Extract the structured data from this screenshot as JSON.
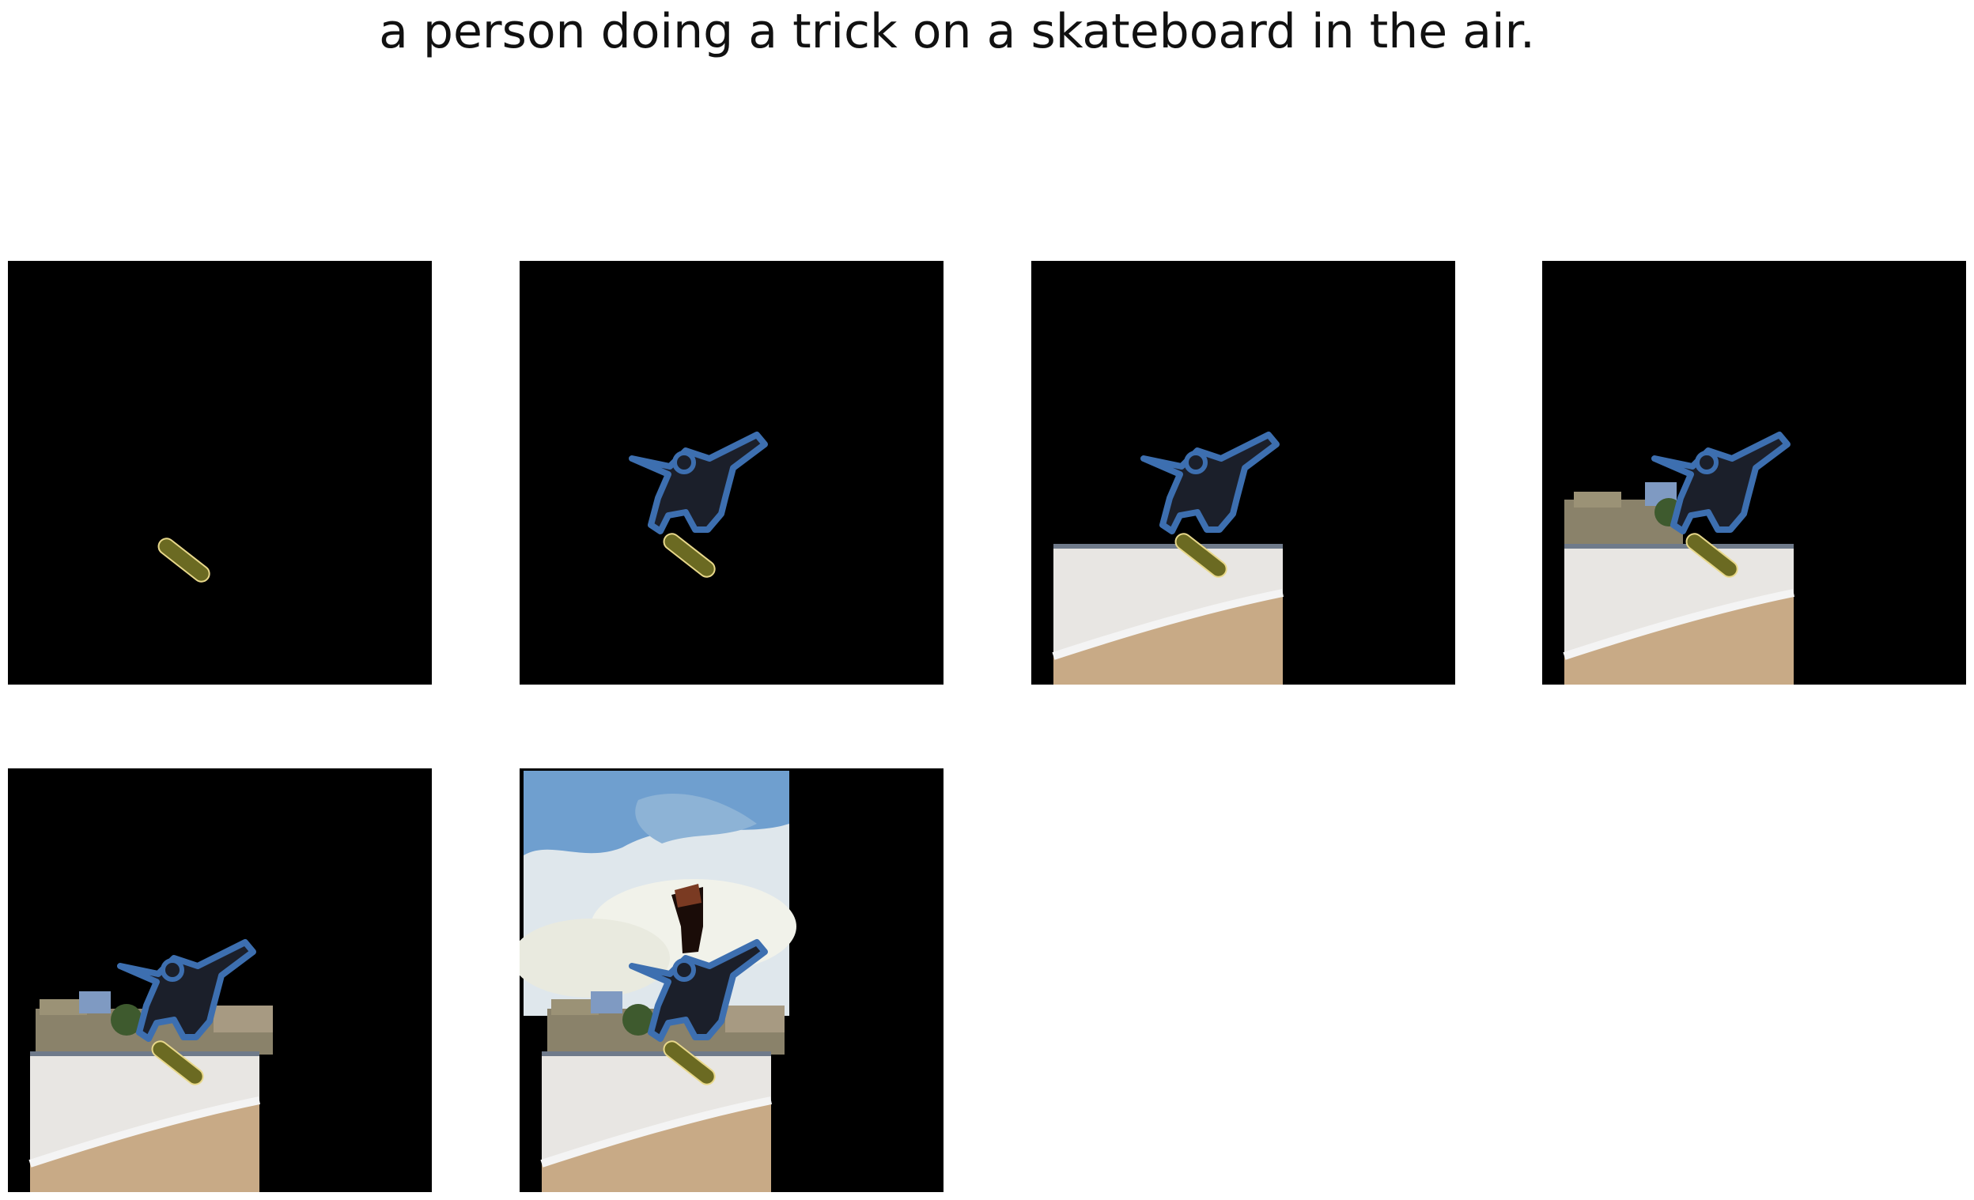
{
  "caption": "a person doing a trick on a skateboard in the air.",
  "colors": {
    "background": "#000000",
    "skateboard": "#6b6a22",
    "outline": "#3d6fb0",
    "skater": "#1b1f2a",
    "ramp": "#d9d6d2",
    "ground": "#c8aa86",
    "trees": "#6f6a55",
    "sky": "#d6e3ee"
  },
  "panels": [
    {
      "name": "panel-1",
      "layers": [
        "skateboard"
      ]
    },
    {
      "name": "panel-2",
      "layers": [
        "skateboard",
        "skater"
      ]
    },
    {
      "name": "panel-3",
      "layers": [
        "ramp",
        "skateboard",
        "skater"
      ]
    },
    {
      "name": "panel-4",
      "layers": [
        "ramp",
        "trees",
        "skateboard",
        "skater"
      ]
    },
    {
      "name": "panel-5",
      "layers": [
        "ramp",
        "trees-wide",
        "skateboard",
        "skater"
      ]
    },
    {
      "name": "panel-6",
      "layers": [
        "sky",
        "ramp",
        "trees-wide",
        "skateboard",
        "skater",
        "flag"
      ]
    }
  ]
}
